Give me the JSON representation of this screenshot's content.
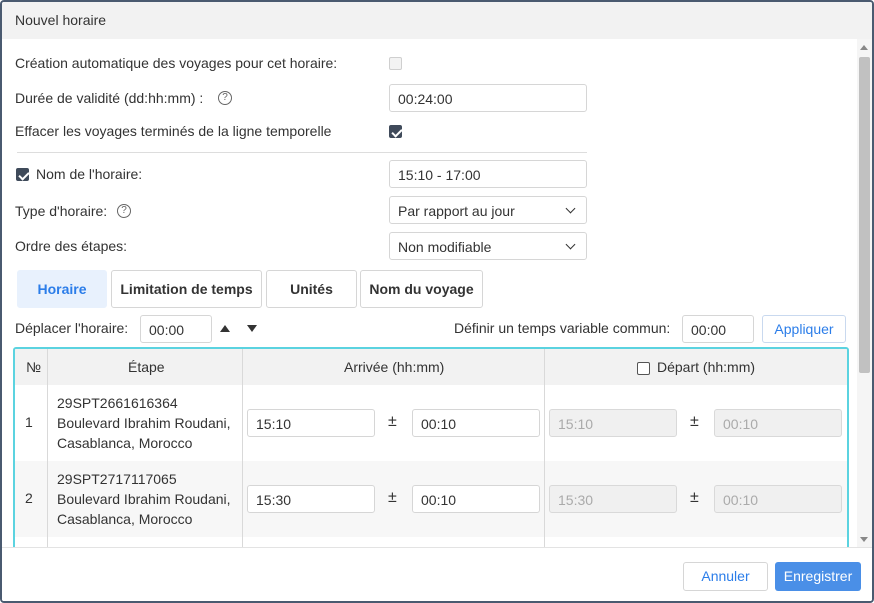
{
  "dialog": {
    "title": "Nouvel horaire"
  },
  "form": {
    "auto_create_label": "Création automatique des voyages pour cet horaire:",
    "auto_create_checked": false,
    "validity_label": "Durée de validité (dd:hh:mm)  :",
    "validity_value": "00:24:00",
    "clear_trips_label": "Effacer les voyages terminés de la ligne temporelle",
    "clear_trips_checked": true,
    "name_label": "Nom de l'horaire:",
    "name_checked": true,
    "name_value": "15:10 - 17:00",
    "type_label": "Type d'horaire:",
    "type_value": "Par rapport au jour",
    "order_label": "Ordre des étapes:",
    "order_value": "Non modifiable",
    "help_glyph": "?"
  },
  "tabs": [
    {
      "label": "Horaire",
      "active": true
    },
    {
      "label": "Limitation de temps",
      "active": false
    },
    {
      "label": "Unités",
      "active": false
    },
    {
      "label": "Nom du voyage",
      "active": false
    }
  ],
  "shift": {
    "label": "Déplacer l'horaire:",
    "value": "00:00",
    "common_label": "Définir un temps variable commun:",
    "common_value": "00:00",
    "apply_label": "Appliquer"
  },
  "table": {
    "headers": {
      "num": "№",
      "stage": "Étape",
      "arrival": "Arrivée (hh:mm)",
      "departure": "Départ (hh:mm)"
    },
    "pm_symbol": "±",
    "rows": [
      {
        "num": "1",
        "stage_id": "29SPT2661616364",
        "addr1": "Boulevard Ibrahim Roudani,",
        "addr2": "Casablanca, Morocco",
        "arrival": "15:10",
        "arrival_var": "00:10",
        "departure": "15:10",
        "departure_var": "00:10"
      },
      {
        "num": "2",
        "stage_id": "29SPT2717117065",
        "addr1": "Boulevard Ibrahim Roudani,",
        "addr2": "Casablanca, Morocco",
        "arrival": "15:30",
        "arrival_var": "00:10",
        "departure": "15:30",
        "departure_var": "00:10"
      }
    ]
  },
  "footer": {
    "cancel_label": "Annuler",
    "save_label": "Enregistrer"
  },
  "colors": {
    "accent": "#2b7de9",
    "primary_button": "#4a8fe7",
    "table_focus_border": "#5bd3e0",
    "active_tab_bg": "#e8f1fd"
  }
}
